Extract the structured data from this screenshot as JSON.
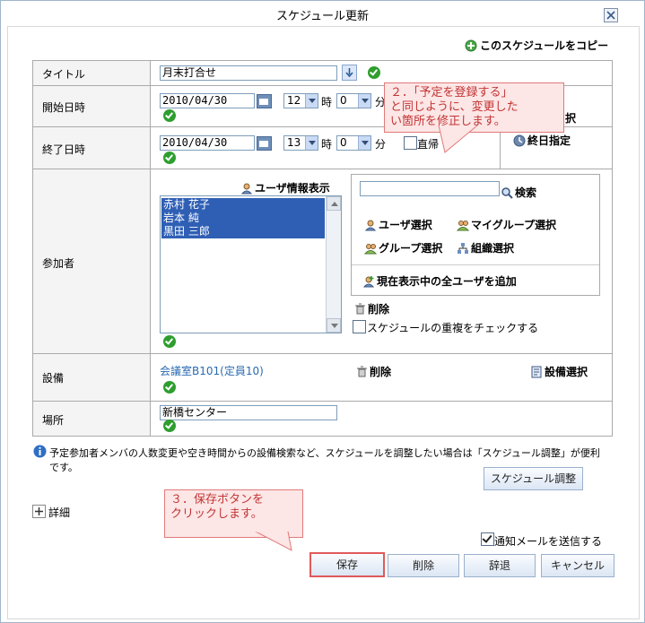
{
  "dialog": {
    "title": "スケジュール更新"
  },
  "copy_link": "このスケジュールをコピー",
  "fields": {
    "title_label": "タイトル",
    "title_value": "月末打合せ",
    "start_label": "開始日時",
    "start_date": "2010/04/30",
    "start_hour": "12",
    "start_min": "0",
    "end_label": "終了日時",
    "end_date": "2010/04/30",
    "end_hour": "13",
    "end_min": "0",
    "hour_unit": "時",
    "min_unit": "分",
    "direct_return": "直帰",
    "day_select_fragment": "択",
    "allday": "終日指定",
    "participants_label": "参加者",
    "user_info_show": "ユーザ情報表示",
    "participants": [
      "赤村  花子",
      "岩本  純",
      "黒田  三郎"
    ],
    "search_placeholder": "",
    "search_btn": "検索",
    "user_select": "ユーザ選択",
    "mygroup_select": "マイグループ選択",
    "group_select": "グループ選択",
    "org_select": "組織選択",
    "add_all_users": "現在表示中の全ユーザを追加",
    "delete": "削除",
    "check_duplicate": "スケジュールの重複をチェックする",
    "equipment_label": "設備",
    "equipment_value": "会議室B101(定員10)",
    "equipment_delete": "削除",
    "equipment_select": "設備選択",
    "place_label": "場所",
    "place_value": "新橋センター"
  },
  "info_text_line1": "予定参加者メンバの人数変更や空き時間からの設備検索など、スケジュールを調整したい場合は「スケジュール調整」が便利",
  "info_text_line2": "です。",
  "schedule_adjust_btn": "スケジュール調整",
  "details": "詳細",
  "notify_mail": "通知メールを送信する",
  "buttons": {
    "save": "保存",
    "delete": "削除",
    "decline": "辞退",
    "cancel": "キャンセル"
  },
  "callout2": [
    "２．「予定を登録する」",
    "と同じように、変更した",
    "い箇所を修正します。"
  ],
  "callout3": [
    "３．保存ボタンを",
    "クリックします。"
  ],
  "colors": {
    "accent": "#2f5fb5",
    "callout_bg": "#fde6e6",
    "callout_text": "#c23434",
    "check_green": "#2e9e2e"
  }
}
